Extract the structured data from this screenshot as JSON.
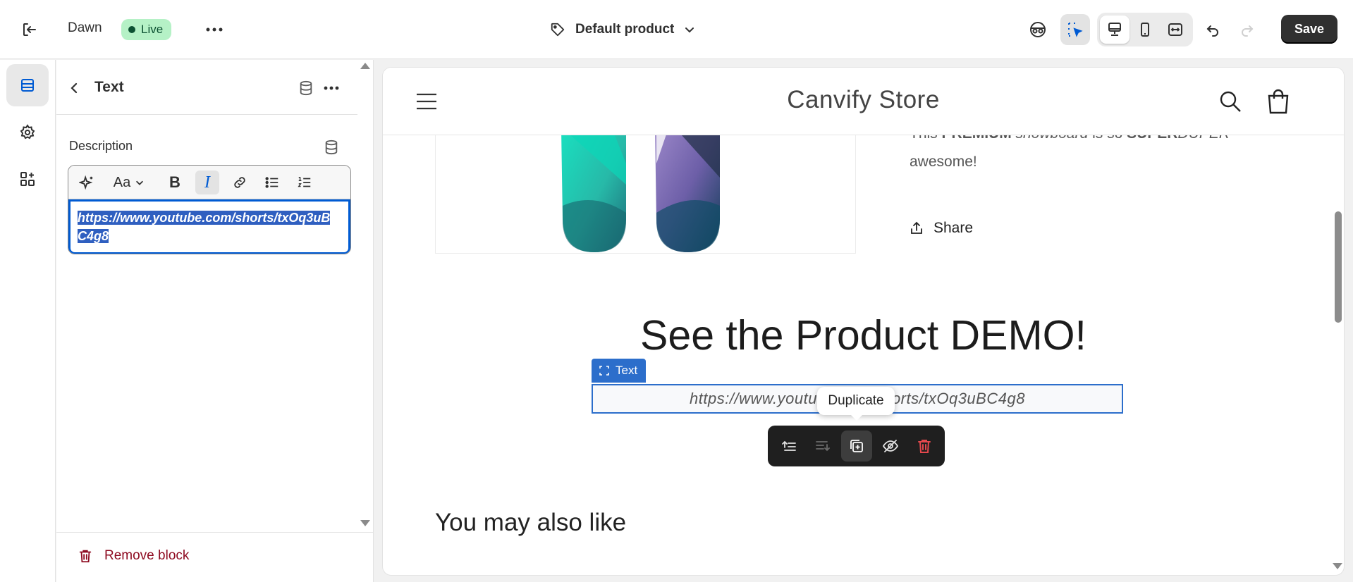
{
  "topbar": {
    "theme_name": "Dawn",
    "live_badge": "Live",
    "template_selector": "Default product",
    "save_label": "Save"
  },
  "panel": {
    "title": "Text",
    "description_label": "Description",
    "text_value_line1": "https://www.youtube.com/shorts/txOq3uB",
    "text_value_line2": "C4g8",
    "remove_block_label": "Remove block"
  },
  "store": {
    "name": "Canvify Store",
    "description_line1_a": "This ",
    "description_line1_b": "PREMIUM",
    "description_line1_c": " snowboard",
    "description_line1_d": " is so ",
    "description_line1_e": "SUPER",
    "description_line1_f": "DUPER",
    "description_line2": "awesome!",
    "share_label": "Share",
    "demo_heading": "See the Product DEMO!",
    "text_block_tag": "Text",
    "text_block_value": "https://www.youtube.com/shorts/txOq3uBC4g8",
    "tooltip_label": "Duplicate",
    "also_like_heading": "You may also like"
  },
  "colors": {
    "accent_blue": "#2c6ecb",
    "live_green": "#b5f1c6",
    "danger_red": "#8e0b21",
    "toolbar_dark": "#1f1f1f"
  },
  "icons": {
    "exit": "exit-icon",
    "more": "more-horizontal-icon",
    "tag": "tag-icon",
    "inspector": "inspector-icon",
    "select": "select-cursor-icon",
    "desktop": "desktop-icon",
    "mobile": "mobile-icon",
    "fullwidth": "full-width-icon",
    "undo": "undo-icon",
    "redo": "redo-icon"
  }
}
